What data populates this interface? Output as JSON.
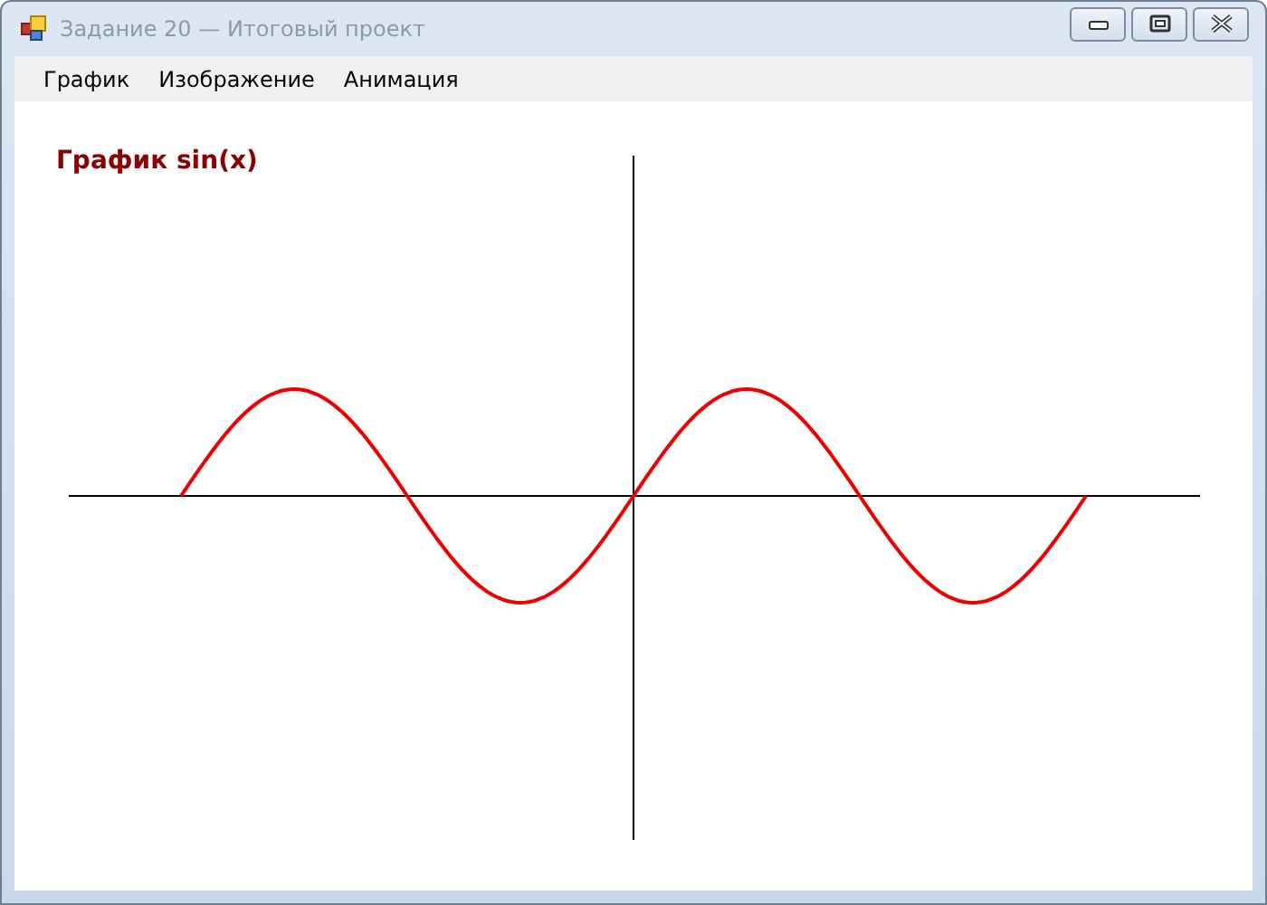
{
  "window": {
    "title": "Задание 20 — Итоговый проект"
  },
  "menu": [
    {
      "label": "График"
    },
    {
      "label": "Изображение"
    },
    {
      "label": "Анимация"
    }
  ],
  "graph": {
    "title": "График sin(x)"
  }
}
